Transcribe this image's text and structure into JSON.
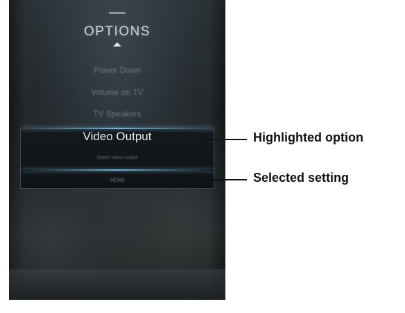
{
  "menu": {
    "title": "OPTIONS",
    "items": [
      {
        "label": "Power Down"
      },
      {
        "label": "Volume on TV"
      },
      {
        "label": "TV Speakers"
      }
    ],
    "highlighted": {
      "label": "Video Output",
      "description": "Select video output",
      "value": "HDMI"
    }
  },
  "callouts": {
    "highlighted_option": "Highlighted option",
    "selected_setting": "Selected setting"
  },
  "colors": {
    "highlight_glow": "#6ebee1",
    "panel_background": "#23292c"
  }
}
